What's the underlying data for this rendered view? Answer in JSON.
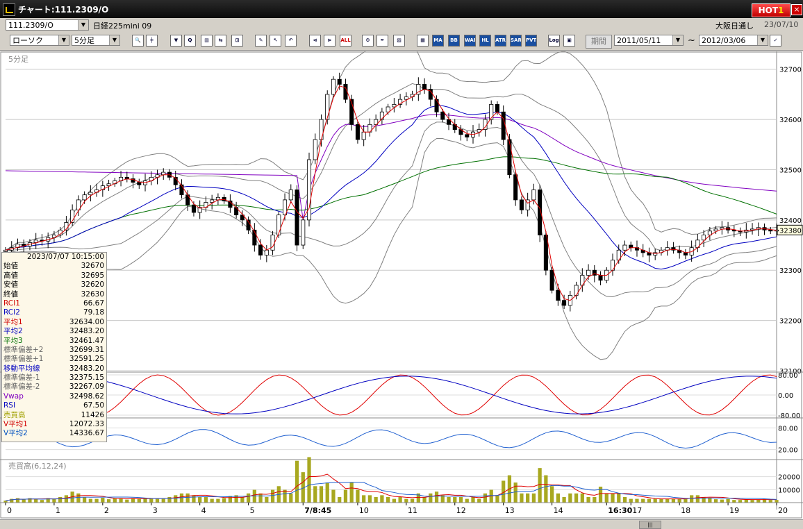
{
  "window": {
    "title": "チャート:111.2309/O",
    "hot_label": "HOT",
    "hot_num": "1",
    "close": "×"
  },
  "header": {
    "symbol_code": "111.2309/O",
    "symbol_name": "日経225mini 09",
    "exchange": "大阪日通し",
    "date": "23/07/10"
  },
  "toolbar": {
    "chart_type": "ローソク",
    "timeframe": "5分足",
    "icons": [
      {
        "name": "zoom-icon",
        "text": "🔍"
      },
      {
        "name": "crosshair-icon",
        "text": "┿"
      },
      {
        "name": "arrow-down-icon",
        "text": "▼"
      },
      {
        "name": "info-icon",
        "text": "Q"
      },
      {
        "name": "bar-chart-icon",
        "text": "▥"
      },
      {
        "name": "flip-icon",
        "text": "⇆"
      },
      {
        "name": "lock-icon",
        "text": "⊡"
      },
      {
        "name": "pencil-icon",
        "text": "✎"
      },
      {
        "name": "cursor-icon",
        "text": "↖"
      },
      {
        "name": "undo-icon",
        "text": "↶"
      },
      {
        "name": "prev-icon",
        "text": "⊲"
      },
      {
        "name": "next-icon",
        "text": "⊳"
      },
      {
        "name": "all-icon",
        "text": "ALL"
      },
      {
        "name": "settings-icon",
        "text": "⚙"
      },
      {
        "name": "tool-icon",
        "text": "✒"
      },
      {
        "name": "color-icon",
        "text": "▨"
      },
      {
        "name": "grid-icon",
        "text": "▦"
      },
      {
        "name": "ma-icon",
        "text": "MA"
      },
      {
        "name": "bb-icon",
        "text": "BB"
      },
      {
        "name": "wae-icon",
        "text": "WAE"
      },
      {
        "name": "hl-icon",
        "text": "HL"
      },
      {
        "name": "atr-icon",
        "text": "ATR"
      },
      {
        "name": "sar-icon",
        "text": "SAR"
      },
      {
        "name": "pvt-icon",
        "text": "PVT"
      },
      {
        "name": "log-icon",
        "text": "Log"
      },
      {
        "name": "layout-icon",
        "text": "▣"
      }
    ],
    "period_label": "期間",
    "date_from": "2011/05/11",
    "tilde": "~",
    "date_to": "2012/03/06",
    "check": "✓"
  },
  "chart_data": {
    "type": "candlestick",
    "panel_label": "5分足",
    "ylim": [
      32100,
      32730
    ],
    "yticks": [
      32700,
      32600,
      32500,
      32400,
      32300,
      32200,
      32100
    ],
    "current_price": 32380,
    "x_labels": [
      {
        "i": 0,
        "t": "0"
      },
      {
        "i": 8,
        "t": "1"
      },
      {
        "i": 16,
        "t": "2"
      },
      {
        "i": 24,
        "t": "3"
      },
      {
        "i": 32,
        "t": "4"
      },
      {
        "i": 40,
        "t": "5"
      },
      {
        "i": 49,
        "t": "7/8:45"
      },
      {
        "i": 58,
        "t": "10"
      },
      {
        "i": 66,
        "t": "11"
      },
      {
        "i": 74,
        "t": "12"
      },
      {
        "i": 82,
        "t": "13"
      },
      {
        "i": 90,
        "t": "14"
      },
      {
        "i": 99,
        "t": "16:30"
      },
      {
        "i": 103,
        "t": "17"
      },
      {
        "i": 111,
        "t": "18"
      },
      {
        "i": 119,
        "t": "19"
      },
      {
        "i": 127,
        "t": "20"
      }
    ],
    "close_path": [
      32340,
      32345,
      32352,
      32348,
      32355,
      32360,
      32358,
      32365,
      32370,
      32380,
      32395,
      32420,
      32440,
      32450,
      32455,
      32460,
      32468,
      32472,
      32478,
      32485,
      32482,
      32475,
      32470,
      32478,
      32485,
      32490,
      32495,
      32485,
      32470,
      32450,
      32430,
      32415,
      32425,
      32435,
      32440,
      32445,
      32438,
      32425,
      32410,
      32400,
      32380,
      32350,
      32330,
      32340,
      32370,
      32410,
      32440,
      32460,
      32350,
      32400,
      32520,
      32560,
      32600,
      32650,
      32680,
      32670,
      32640,
      32590,
      32560,
      32575,
      32590,
      32600,
      32615,
      32625,
      32630,
      32640,
      32645,
      32650,
      32670,
      32660,
      32640,
      32615,
      32600,
      32590,
      32580,
      32570,
      32565,
      32575,
      32580,
      32600,
      32630,
      32615,
      32560,
      32490,
      32440,
      32420,
      32440,
      32460,
      32370,
      32300,
      32260,
      32240,
      32230,
      32250,
      32270,
      32290,
      32300,
      32290,
      32280,
      32300,
      32320,
      32340,
      32350,
      32345,
      32340,
      32335,
      32330,
      32335,
      32340,
      32345,
      32340,
      32335,
      32330,
      32345,
      32360,
      32370,
      32378,
      32382,
      32385,
      32380,
      32378,
      32376,
      32380,
      32382,
      32385,
      32380,
      32378,
      32380
    ],
    "oscillator": {
      "yticks": [
        "80.00",
        "0.00",
        "-80.00"
      ]
    },
    "rsi": {
      "yticks": [
        "80.00",
        "20.00"
      ]
    },
    "volume": {
      "label": "売買高(6,12,24)",
      "yticks": [
        "20000",
        "10000"
      ]
    }
  },
  "info": {
    "datetime": "2023/07/07  10:15:00",
    "rows": [
      {
        "label": "始値",
        "value": "32670",
        "color": "#000000"
      },
      {
        "label": "高値",
        "value": "32695",
        "color": "#000000"
      },
      {
        "label": "安値",
        "value": "32620",
        "color": "#000000"
      },
      {
        "label": "終値",
        "value": "32630",
        "color": "#000000"
      },
      {
        "label": "RCI1",
        "value": "66.67",
        "color": "#d00000"
      },
      {
        "label": "RCI2",
        "value": "79.18",
        "color": "#0000c0"
      },
      {
        "label": "平均1",
        "value": "32634.00",
        "color": "#d00000"
      },
      {
        "label": "平均2",
        "value": "32483.20",
        "color": "#0000c0"
      },
      {
        "label": "平均3",
        "value": "32461.47",
        "color": "#007000"
      },
      {
        "label": "標準偏差+2",
        "value": "32699.31",
        "color": "#666666"
      },
      {
        "label": "標準偏差+1",
        "value": "32591.25",
        "color": "#666666"
      },
      {
        "label": "移動平均線",
        "value": "32483.20",
        "color": "#0000c0"
      },
      {
        "label": "標準偏差-1",
        "value": "32375.15",
        "color": "#666666"
      },
      {
        "label": "標準偏差-2",
        "value": "32267.09",
        "color": "#666666"
      },
      {
        "label": "Vwap",
        "value": "32498.62",
        "color": "#8000c0"
      },
      {
        "label": "RSI",
        "value": "67.50",
        "color": "#0000c0"
      },
      {
        "label": "売買高",
        "value": "11426",
        "color": "#a0a000"
      },
      {
        "label": "V平均1",
        "value": "12072.33",
        "color": "#d00000"
      },
      {
        "label": "V平均2",
        "value": "14336.67",
        "color": "#0050c0"
      }
    ]
  },
  "colors": {
    "up": "#ffffff",
    "down": "#000000",
    "ma1": "#e00000",
    "ma2": "#0000c0",
    "ma3": "#007000",
    "band": "#808080",
    "vwap": "#8000c0",
    "rsi": "#2060d0",
    "vol": "#a8a820"
  }
}
